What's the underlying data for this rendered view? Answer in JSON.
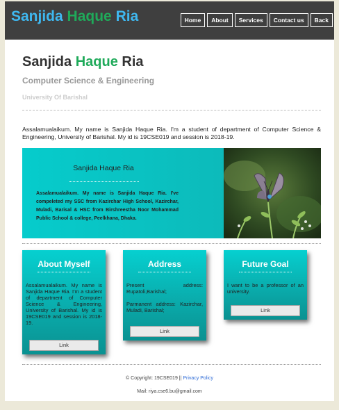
{
  "brand": {
    "part1": "Sanjida",
    "part2": "Haque",
    "part3": "Ria"
  },
  "nav": {
    "home": "Home",
    "about": "About",
    "services": "Services",
    "contact": "Contact us",
    "back": "Back"
  },
  "hero": {
    "name1": "Sanjida",
    "name2": "Haque",
    "name3": "Ria",
    "department": "Computer Science & Engineering",
    "university": "University Of Barishal"
  },
  "intro": "Assalamualaikum. My name is Sanjida Haque Ria. I'm a student of department of Computer Science & Engineering, University of Barishal. My id is 19CSE019 and session is 2018-19.",
  "banner": {
    "title": "Sanjida Haque Ria",
    "text": "Assalamualaikum. My name is Sanjida Haque Ria. I've compeleted my SSC from Kazirchar High School, Kazirchar, Muladi, Barisal & HSC from Birshreestha Noor Mohammad Public School & college, Peelkhana, Dhaka."
  },
  "cards": [
    {
      "title": "About Myself",
      "text": "Assalamualaikum. My name is Sanjida Haque Ria. I'm a student of department of Computer Science & Engineering, University of Barishal. My id is 19CSE019 and session is 2018-19.",
      "button": "Link"
    },
    {
      "title": "Address",
      "line1": "Present address: Rupatoli,Barishal;",
      "line2": "Parmanent address: Kazirchar, Muladi, Barishal;",
      "button": "Link"
    },
    {
      "title": "Future Goal",
      "text": "I want to be a professor of an university.",
      "button": "Link"
    }
  ],
  "footer": {
    "copyright": "© Copyright: 19CSE019 ||",
    "privacy": "Privacy Policy",
    "mail": "Mail: riya.cse6.bu@gmail.com"
  },
  "colors": {
    "header_bg": "#3f3f3f",
    "brand_blue": "#3fb8f0",
    "brand_green": "#1faa5a",
    "teal": "#06cccc"
  }
}
